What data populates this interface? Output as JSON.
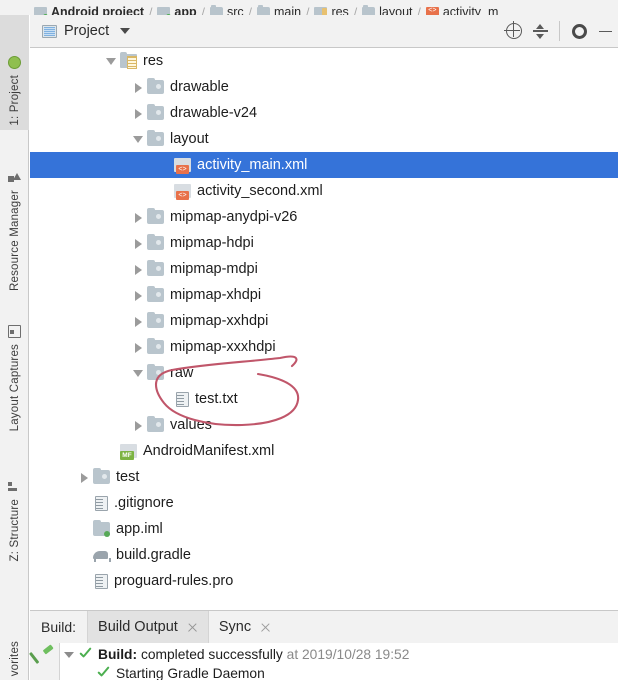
{
  "breadcrumb": {
    "items": [
      {
        "label": "Android project",
        "icon": "android-project-icon",
        "bold": true
      },
      {
        "label": "app",
        "icon": "module-app-icon",
        "bold": true
      },
      {
        "label": "src",
        "icon": "folder-icon",
        "bold": false
      },
      {
        "label": "main",
        "icon": "folder-icon",
        "bold": false
      },
      {
        "label": "res",
        "icon": "res-folder-icon",
        "bold": false
      },
      {
        "label": "layout",
        "icon": "folder-icon",
        "bold": false
      },
      {
        "label": "activity_m",
        "icon": "xml-file-icon",
        "bold": false
      }
    ],
    "separator": "/"
  },
  "left_toolbar": {
    "items": [
      {
        "label": "1: Project",
        "icon": "android-head-icon",
        "active": true
      },
      {
        "label": "Resource Manager",
        "icon": "resource-manager-icon",
        "active": false
      },
      {
        "label": "Layout Captures",
        "icon": "layout-captures-icon",
        "active": false
      },
      {
        "label": "Z: Structure",
        "icon": "structure-icon",
        "active": false
      },
      {
        "label": "vorites",
        "icon": "favorites-icon",
        "active": false
      }
    ]
  },
  "project_panel": {
    "title": "Project",
    "title_icon": "project-view-icon",
    "caret_icon": "chevron-down-icon",
    "tools": [
      {
        "name": "locate-icon",
        "label": "Select Opened File"
      },
      {
        "name": "collapse-all-icon",
        "label": "Collapse All"
      },
      {
        "name": "gear-icon",
        "label": "Settings"
      },
      {
        "name": "minimize-icon",
        "label": "Hide"
      }
    ]
  },
  "tree": {
    "rows": [
      {
        "label": "res",
        "indent": 0,
        "twisty": "expanded",
        "icon": "res-folder-icon",
        "selected": false
      },
      {
        "label": "drawable",
        "indent": 1,
        "twisty": "collapsed",
        "icon": "folder-icon",
        "selected": false
      },
      {
        "label": "drawable-v24",
        "indent": 1,
        "twisty": "collapsed",
        "icon": "folder-icon",
        "selected": false
      },
      {
        "label": "layout",
        "indent": 1,
        "twisty": "expanded",
        "icon": "folder-icon",
        "selected": false
      },
      {
        "label": "activity_main.xml",
        "indent": 2,
        "twisty": "none",
        "icon": "xml-file-icon",
        "selected": true
      },
      {
        "label": "activity_second.xml",
        "indent": 2,
        "twisty": "none",
        "icon": "xml-file-icon",
        "selected": false
      },
      {
        "label": "mipmap-anydpi-v26",
        "indent": 1,
        "twisty": "collapsed",
        "icon": "folder-icon",
        "selected": false
      },
      {
        "label": "mipmap-hdpi",
        "indent": 1,
        "twisty": "collapsed",
        "icon": "folder-icon",
        "selected": false
      },
      {
        "label": "mipmap-mdpi",
        "indent": 1,
        "twisty": "collapsed",
        "icon": "folder-icon",
        "selected": false
      },
      {
        "label": "mipmap-xhdpi",
        "indent": 1,
        "twisty": "collapsed",
        "icon": "folder-icon",
        "selected": false
      },
      {
        "label": "mipmap-xxhdpi",
        "indent": 1,
        "twisty": "collapsed",
        "icon": "folder-icon",
        "selected": false
      },
      {
        "label": "mipmap-xxxhdpi",
        "indent": 1,
        "twisty": "collapsed",
        "icon": "folder-icon",
        "selected": false
      },
      {
        "label": "raw",
        "indent": 1,
        "twisty": "expanded",
        "icon": "folder-icon",
        "selected": false
      },
      {
        "label": "test.txt",
        "indent": 2,
        "twisty": "none",
        "icon": "text-file-icon",
        "selected": false
      },
      {
        "label": "values",
        "indent": 1,
        "twisty": "collapsed",
        "icon": "folder-icon",
        "selected": false
      },
      {
        "label": "AndroidManifest.xml",
        "indent": 0,
        "twisty": "none",
        "icon": "manifest-file-icon",
        "selected": false
      },
      {
        "label": "test",
        "indent": -1,
        "twisty": "collapsed",
        "icon": "folder-icon",
        "selected": false
      },
      {
        "label": ".gitignore",
        "indent": -1,
        "twisty": "none",
        "icon": "text-file-icon",
        "selected": false
      },
      {
        "label": "app.iml",
        "indent": -1,
        "twisty": "none",
        "icon": "iml-file-icon",
        "selected": false
      },
      {
        "label": "build.gradle",
        "indent": -1,
        "twisty": "none",
        "icon": "gradle-file-icon",
        "selected": false
      },
      {
        "label": "proguard-rules.pro",
        "indent": -1,
        "twisty": "none",
        "icon": "text-file-icon",
        "selected": false
      }
    ],
    "annotation": {
      "name": "red-ellipse-annotation",
      "color": "#c0566a",
      "encircles": [
        "raw",
        "test.txt"
      ]
    }
  },
  "build_window": {
    "label": "Build:",
    "tabs": [
      {
        "label": "Build Output",
        "active": true,
        "closable": true
      },
      {
        "label": "Sync",
        "active": false,
        "closable": true
      }
    ],
    "gutter_icon": "hammer-icon",
    "lines": [
      {
        "indent": 0,
        "twisty": "expanded",
        "status_icon": "check-icon",
        "bold_text": "Build:",
        "normal_text": "completed successfully",
        "dim_text": "at 2019/10/28 19:52"
      },
      {
        "indent": 1,
        "twisty": "none",
        "status_icon": "check-icon",
        "bold_text": "",
        "normal_text": "Starting Gradle Daemon",
        "dim_text": ""
      }
    ]
  },
  "colors": {
    "selection_blue": "#3573d9",
    "chrome_grey": "#f2f2f2",
    "annotation_red": "#c0566a",
    "success_green": "#4caf50"
  }
}
